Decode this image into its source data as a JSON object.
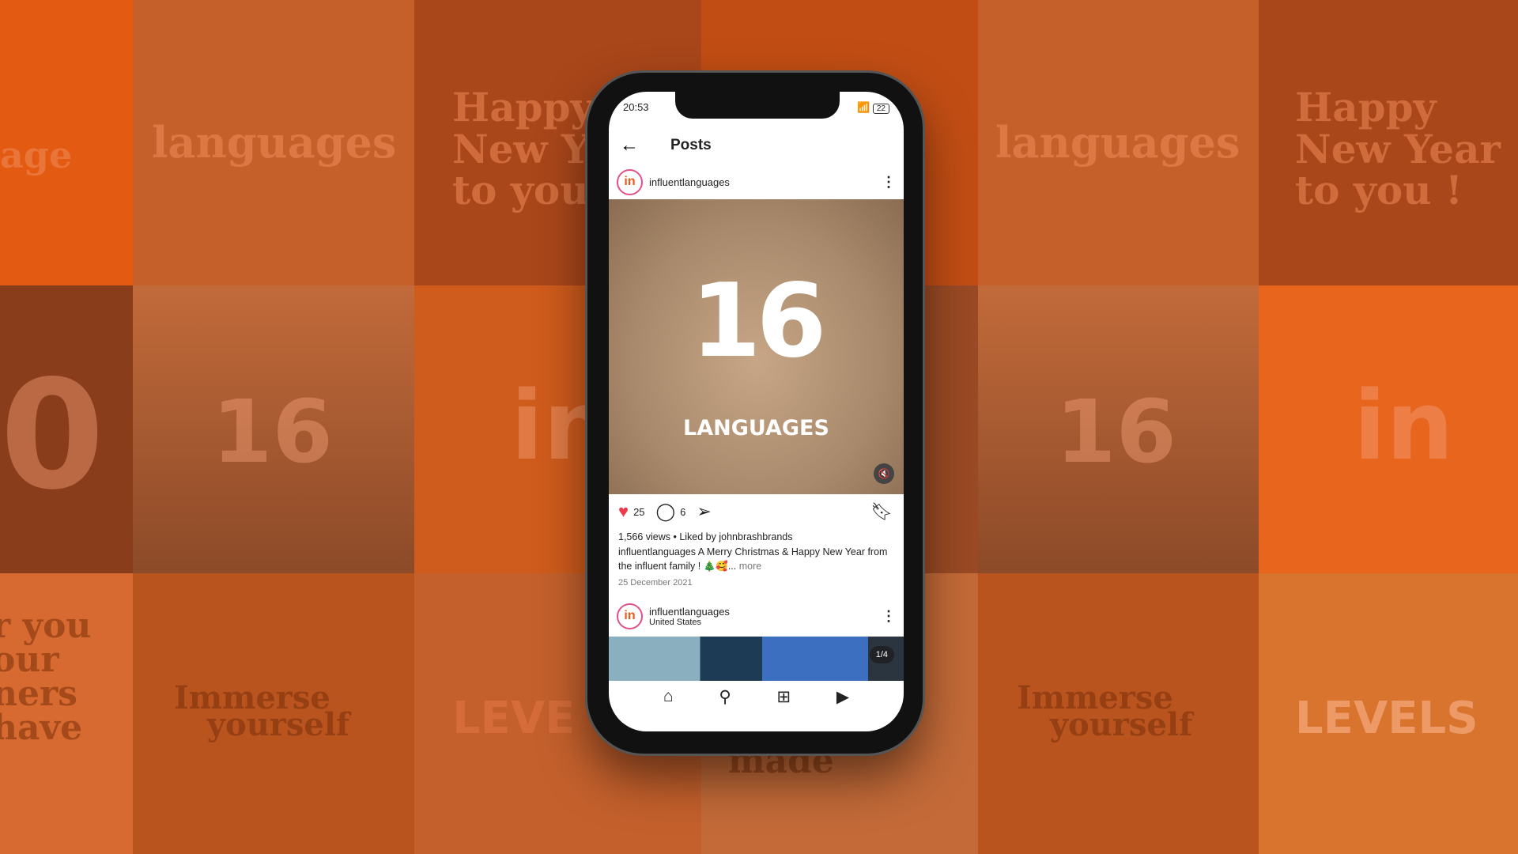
{
  "background": {
    "tiles_text": [
      "age",
      "languages",
      "Happy\nNew Y\nto you",
      "0",
      "16",
      "in",
      "r you\nour\nners\nhave",
      "Immerse\n   yourself",
      "LEVE",
      "made",
      "languages",
      "Happy\nNew Year\nto you !",
      "16",
      "in",
      "Immerse\n   yourself",
      "LEVELS"
    ],
    "accent": "#e8601c"
  },
  "status_bar": {
    "time": "20:53",
    "battery": "22"
  },
  "header": {
    "title": "Posts",
    "back_icon": "arrow-left-icon"
  },
  "post": {
    "username": "influentlanguages",
    "media_number": "16",
    "media_label": "LANGUAGES",
    "likes": "25",
    "comments": "6",
    "views_line": "1,566 views • Liked by johnbrashbrands",
    "caption_user": "influentlanguages",
    "caption": "A Merry Christmas & Happy New Year from the influent family ! 🎄🥰...",
    "more": "more",
    "date": "25 December 2021"
  },
  "next_post": {
    "username": "influentlanguages",
    "location": "United States",
    "counter": "1/4"
  },
  "nav": [
    "home-icon",
    "search-icon",
    "create-icon",
    "reels-icon"
  ]
}
